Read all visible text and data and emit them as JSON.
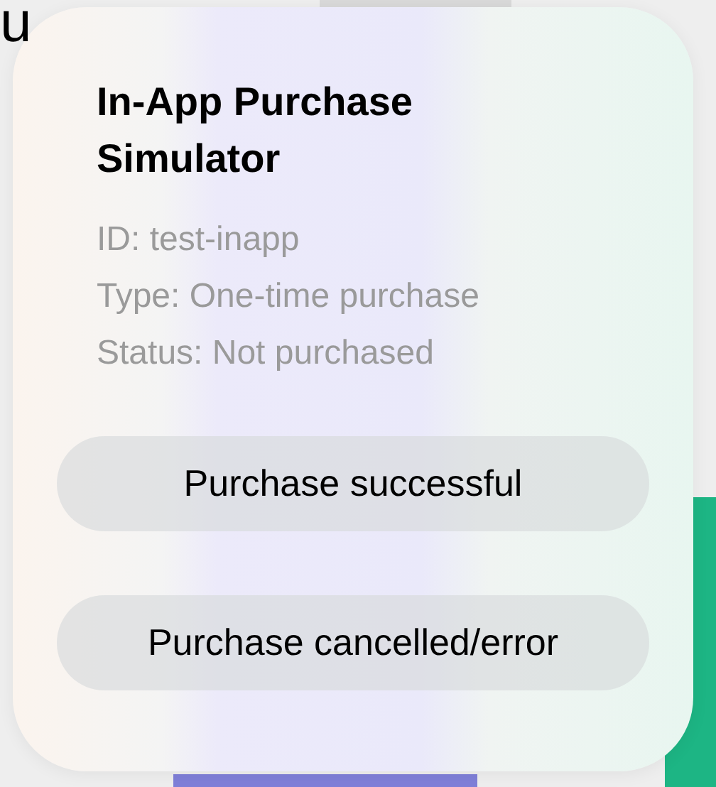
{
  "background": {
    "heading": "u"
  },
  "alert": {
    "title": "In-App Purchase Simulator",
    "details": [
      "ID: test-inapp",
      "Type: One-time purchase",
      "Status: Not purchased"
    ],
    "buttons": [
      "Purchase successful",
      "Purchase cancelled/error"
    ]
  }
}
